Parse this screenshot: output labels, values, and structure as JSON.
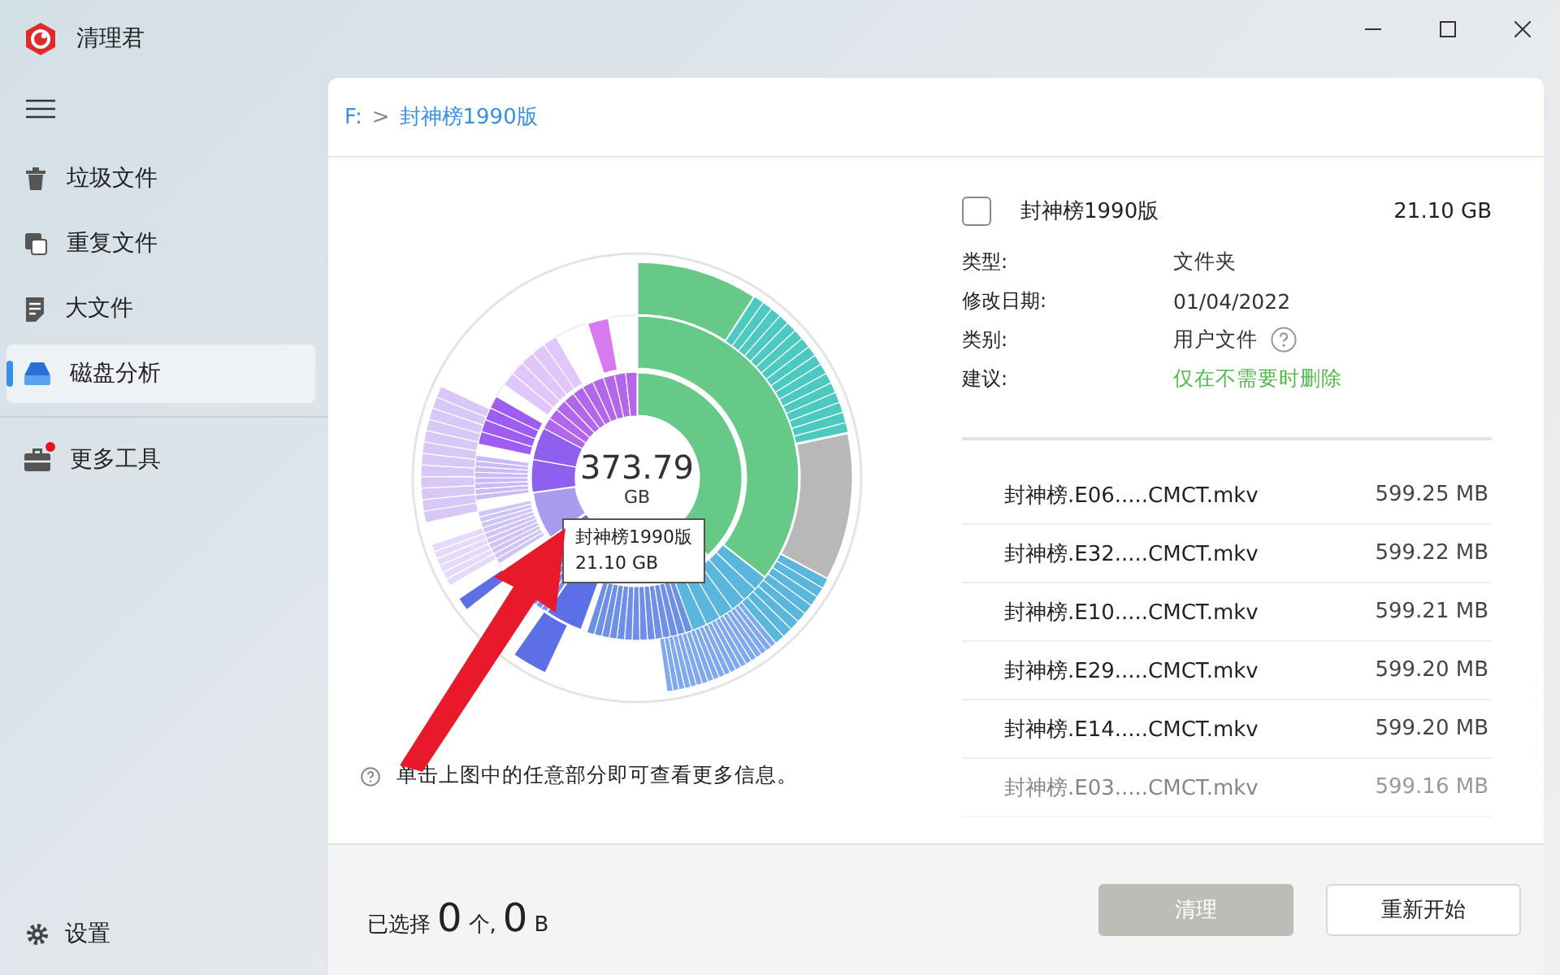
{
  "window": {
    "title": "清理君"
  },
  "sidebar": {
    "items": [
      {
        "kind": "trash",
        "label": "垃圾文件",
        "selected": false,
        "notification": false
      },
      {
        "kind": "duplicate",
        "label": "重复文件",
        "selected": false,
        "notification": false
      },
      {
        "kind": "document",
        "label": "大文件",
        "selected": false,
        "notification": false
      },
      {
        "kind": "disk",
        "label": "磁盘分析",
        "selected": true,
        "notification": false
      },
      {
        "kind": "toolbox",
        "label": "更多工具",
        "selected": false,
        "notification": true
      }
    ],
    "settings": "设置"
  },
  "breadcrumb": {
    "root": "F:",
    "separator": ">",
    "current": "封神榜1990版"
  },
  "chart": {
    "total": "373.79",
    "unit": "GB",
    "tooltip": {
      "name": "封神榜1990版",
      "size": "21.10 GB"
    }
  },
  "hint": "单击上图中的任意部分即可查看更多信息。",
  "details": {
    "checked": false,
    "name": "封神榜1990版",
    "size": "21.10 GB",
    "fields": [
      {
        "kind": "plain",
        "label": "类型:",
        "value": "文件夹"
      },
      {
        "kind": "plain",
        "label": "修改日期:",
        "value": "01/04/2022"
      },
      {
        "kind": "help",
        "label": "类别:",
        "value": "用户文件"
      },
      {
        "kind": "advice",
        "label": "建议:",
        "value": "仅在不需要时删除"
      }
    ]
  },
  "files": [
    {
      "name": "封神榜.E06.....CMCT.mkv",
      "size": "599.25 MB",
      "faded": false
    },
    {
      "name": "封神榜.E32.....CMCT.mkv",
      "size": "599.22 MB",
      "faded": false
    },
    {
      "name": "封神榜.E10.....CMCT.mkv",
      "size": "599.21 MB",
      "faded": false
    },
    {
      "name": "封神榜.E29.....CMCT.mkv",
      "size": "599.20 MB",
      "faded": false
    },
    {
      "name": "封神榜.E14.....CMCT.mkv",
      "size": "599.20 MB",
      "faded": false
    },
    {
      "name": "封神榜.E03.....CMCT.mkv",
      "size": "599.16 MB",
      "faded": true
    }
  ],
  "footer": {
    "prefix": "已选择",
    "count": "0",
    "count_unit": "个,",
    "size": "0",
    "size_unit": "B",
    "buttons": [
      {
        "label": "清理",
        "disabled": true
      },
      {
        "label": "重新开始",
        "disabled": false
      }
    ]
  }
}
